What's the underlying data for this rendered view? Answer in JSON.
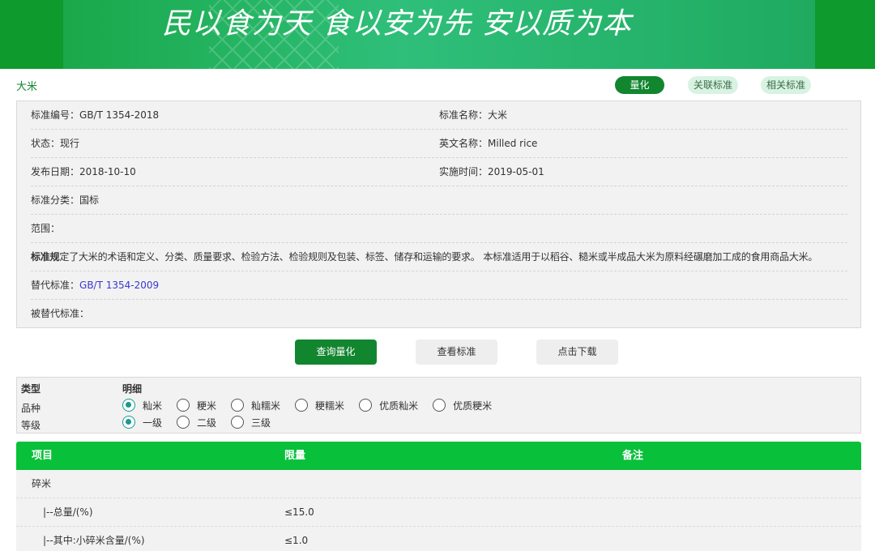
{
  "banner": {
    "slogan": "民以食为天 食以安为先 安以质为本"
  },
  "header": {
    "title": "大米",
    "tabs": [
      {
        "label": "量化",
        "active": true
      },
      {
        "label": "关联标准",
        "active": false
      },
      {
        "label": "相关标准",
        "active": false
      }
    ]
  },
  "info": {
    "standard_no": {
      "label": "标准编号：",
      "value": "GB/T 1354-2018"
    },
    "standard_name": {
      "label": "标准名称：",
      "value": "大米"
    },
    "status": {
      "label": "状态：",
      "value": "现行"
    },
    "english_name": {
      "label": "英文名称：",
      "value": "Milled rice"
    },
    "publish_date": {
      "label": "发布日期：",
      "value": "2018-10-10"
    },
    "implement_date": {
      "label": "实施时间：",
      "value": "2019-05-01"
    },
    "category": {
      "label": "标准分类：",
      "value": "国标"
    },
    "scope": {
      "label": "范围：",
      "value": ""
    },
    "scope_text": {
      "bold": "标准规",
      "overlap": "本标准规定",
      "rest": "定了大米的术语和定义、分类、质量要求、检验方法、检验规则及包装、标签、储存和运输的要求。 本标准适用于以稻谷、糙米或半成品大米为原料经碾磨加工成的食用商品大米。"
    },
    "replaces": {
      "label": "替代标准：",
      "value": "GB/T 1354-2009"
    },
    "replaced_by": {
      "label": "被替代标准：",
      "value": ""
    }
  },
  "actions": {
    "query": "查询量化",
    "view": "查看标准",
    "download": "点击下载"
  },
  "filters": {
    "type_header": "类型",
    "detail_header": "明细",
    "variety_label": "品种",
    "grade_label": "等级",
    "variety_options": [
      {
        "label": "籼米",
        "checked": true
      },
      {
        "label": "粳米",
        "checked": false
      },
      {
        "label": "籼糯米",
        "checked": false
      },
      {
        "label": "粳糯米",
        "checked": false
      },
      {
        "label": "优质籼米",
        "checked": false
      },
      {
        "label": "优质粳米",
        "checked": false
      }
    ],
    "grade_options": [
      {
        "label": "一级",
        "checked": true
      },
      {
        "label": "二级",
        "checked": false
      },
      {
        "label": "三级",
        "checked": false
      }
    ]
  },
  "table": {
    "headers": {
      "item": "项目",
      "limit": "限量",
      "note": "备注"
    },
    "rows": [
      {
        "item": "碎米",
        "limit": "",
        "note": ""
      },
      {
        "item": "|--总量/(%)",
        "limit": "≤15.0",
        "note": ""
      },
      {
        "item": "|--其中:小碎米含量/(%)",
        "limit": "≤1.0",
        "note": ""
      }
    ]
  },
  "colors": {
    "brand_green": "#12862f",
    "header_green": "#09c03a",
    "link_blue": "#3b36d1",
    "radio_teal": "#1a9a8f"
  }
}
